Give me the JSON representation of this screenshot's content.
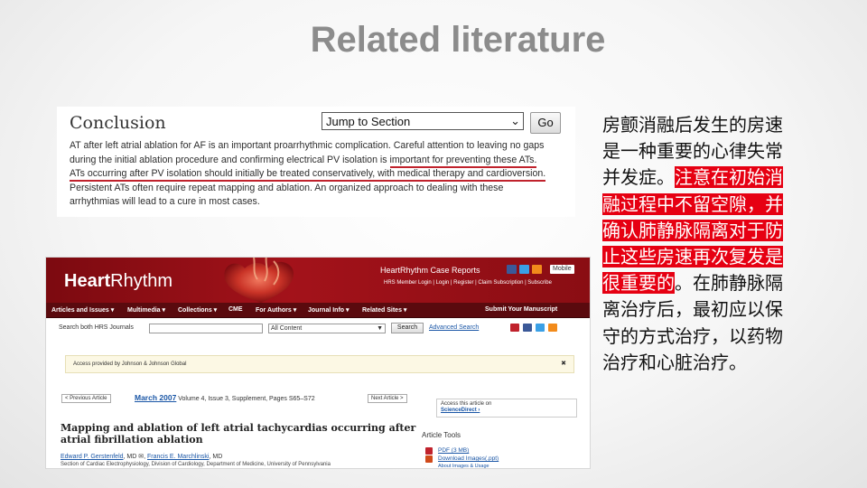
{
  "slide": {
    "title": "Related literature"
  },
  "conclusion": {
    "heading": "Conclusion",
    "jump_select": "Jump to Section",
    "go_button": "Go",
    "lines": [
      {
        "plain": "AT after left atrial ablation for AF is an important proarrhythmic complication. Careful attention to leaving no gaps",
        "ul": ""
      },
      {
        "plain": "during the initial ablation procedure and confirming electrical PV isolation is ",
        "ul": "important for preventing these ATs."
      },
      {
        "plain": "",
        "ul": "ATs occurring after PV isolation should initially be treated conservatively, with medical therapy and cardioversion."
      },
      {
        "plain": "Persistent ATs often require repeat mapping and ablation. An organized approach to dealing with these",
        "ul": ""
      },
      {
        "plain": "arrhythmias will lead to a cure in most cases.",
        "ul": ""
      }
    ]
  },
  "journal": {
    "logo_bold": "Heart",
    "logo_rest": "Rhythm",
    "case_reports": "HeartRhythm Case Reports",
    "mobile": "Mobile",
    "top_links": "HRS Member Login | Login | Register | Claim Subscription | Subscribe",
    "nav": [
      "Articles and Issues ▾",
      "Multimedia ▾",
      "Collections ▾",
      "CME",
      "For Authors ▾",
      "Journal Info ▾",
      "Related Sites ▾",
      "Submit Your Manuscript"
    ],
    "search_label": "Search both HRS Journals",
    "search_scope": "All Content",
    "search_button": "Search",
    "advanced_search": "Advanced Search",
    "access_text": "Access provided by Johnson & Johnson Global",
    "prev_article": "< Previous Article",
    "next_article": "Next Article >",
    "issue_date": "March 2007",
    "issue_details": " Volume 4, Issue 3, Supplement, Pages S65–S72",
    "sd_prefix": "Access this article on",
    "sd_name": "ScienceDirect ›",
    "article_title": "Mapping and ablation of left atrial tachycardias occurring after atrial fibrillation ablation",
    "author1": "Edward P. Gerstenfeld",
    "author1_suffix": ", MD",
    "author2": "Francis E. Marchlinski",
    "author2_suffix": ", MD",
    "affiliation": "Section of Cardiac Electrophysiology, Division of Cardiology, Department of Medicine, University of Pennsylvania",
    "tools_heading": "Article Tools",
    "tool_pdf": "PDF (3 MB)",
    "tool_images": "Download Images(.ppt)",
    "tool_about": "About Images & Usage"
  },
  "chinese": {
    "lines": [
      [
        {
          "t": "房颤消融后发生的房速",
          "hl": false
        }
      ],
      [
        {
          "t": "是一种重要的心律失常",
          "hl": false
        }
      ],
      [
        {
          "t": "并发症。",
          "hl": false
        },
        {
          "t": "注意在初始消",
          "hl": true
        }
      ],
      [
        {
          "t": "融过程中不留空隙，并",
          "hl": true
        }
      ],
      [
        {
          "t": "确认肺静脉隔离对于防",
          "hl": true
        }
      ],
      [
        {
          "t": "止这些房速再次复发是",
          "hl": true
        }
      ],
      [
        {
          "t": "很重要的",
          "hl": true
        },
        {
          "t": "。在肺静脉隔",
          "hl": false
        }
      ],
      [
        {
          "t": "离治疗后，最初应以保",
          "hl": false
        }
      ],
      [
        {
          "t": "守的方式治疗，以药物",
          "hl": false
        }
      ],
      [
        {
          "t": "治疗和心脏治疗。",
          "hl": false
        }
      ]
    ]
  },
  "colors": {
    "highlight": "#e60012",
    "underline": "#c0222c",
    "banner": "#a3121a",
    "link": "#1a56a6"
  }
}
